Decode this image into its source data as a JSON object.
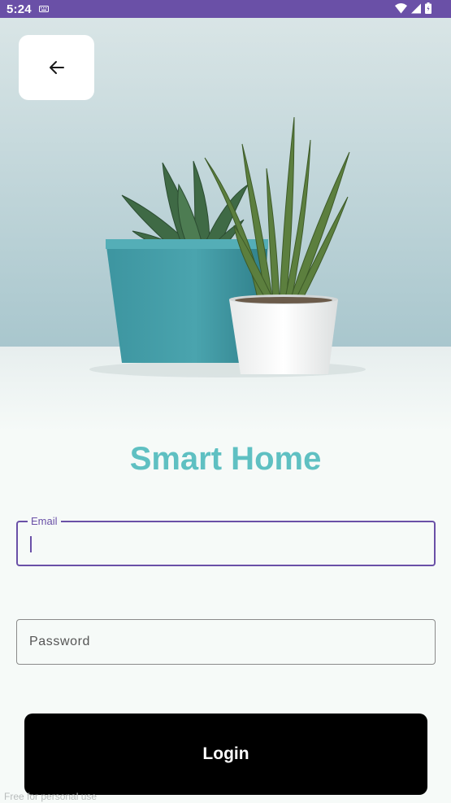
{
  "status_bar": {
    "time": "5:24",
    "keyboard_icon": "keyboard-icon",
    "wifi_icon": "wifi-icon",
    "signal_icon": "signal-icon",
    "battery_icon": "battery-icon",
    "background": "#6a50a7"
  },
  "header": {
    "back_icon": "arrow-back-icon"
  },
  "hero": {
    "image": "potted-plants-photo"
  },
  "title": {
    "text": "Smart Home",
    "color": "#5fc0c2"
  },
  "form": {
    "email": {
      "label": "Email",
      "value": ""
    },
    "password": {
      "placeholder": "Password",
      "value": ""
    },
    "login_label": "Login"
  },
  "footer": {
    "watermark": "Free for personal use"
  },
  "colors": {
    "accent": "#6a50a7",
    "title": "#5fc0c2",
    "button": "#000000",
    "background": "#f6faf8"
  }
}
